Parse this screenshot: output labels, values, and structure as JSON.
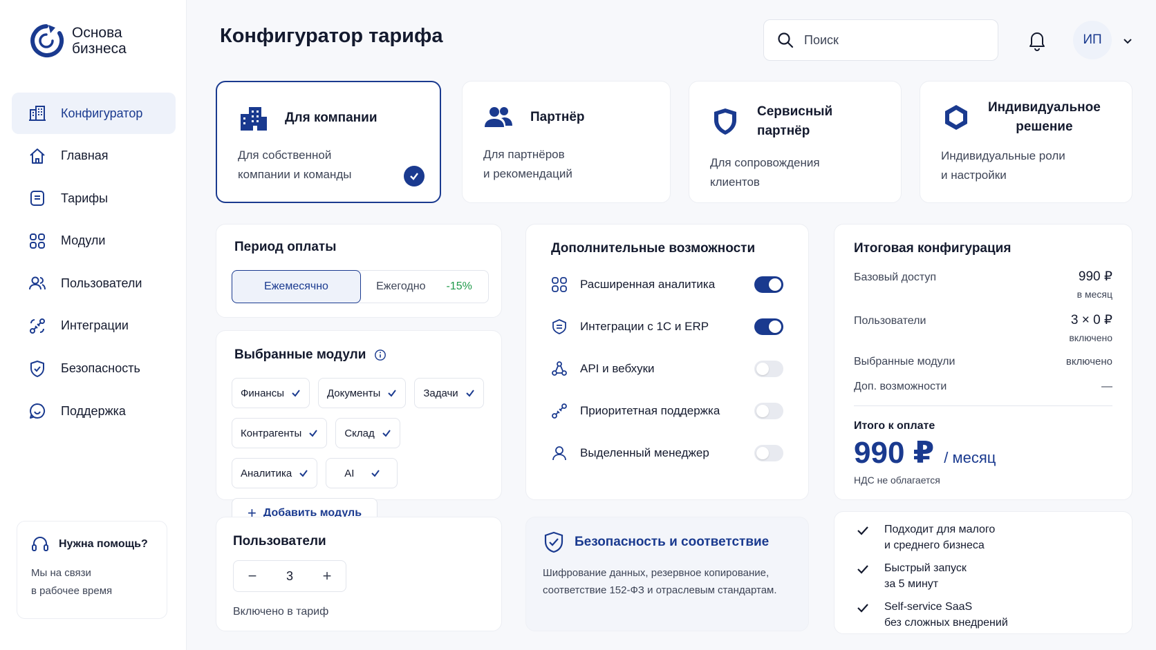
{
  "brand": {
    "line1": "Основа",
    "line2": "бизнеса"
  },
  "sidebar": {
    "items": [
      {
        "label": "Конфигуратор",
        "icon": "building-icon"
      },
      {
        "label": "Главная",
        "icon": "home-icon"
      },
      {
        "label": "Тарифы",
        "icon": "tariff-icon"
      },
      {
        "label": "Модули",
        "icon": "modules-icon"
      },
      {
        "label": "Пользователи",
        "icon": "users-icon"
      },
      {
        "label": "Интеграции",
        "icon": "integrations-icon"
      },
      {
        "label": "Безопасность",
        "icon": "shield-icon"
      },
      {
        "label": "Поддержка",
        "icon": "chat-icon"
      }
    ],
    "help": {
      "title": "Нужна помощь?",
      "line1": "Мы на связи",
      "line2": "в рабочее время"
    }
  },
  "header": {
    "title": "Конфигуратор тарифа",
    "search_placeholder": "Поиск",
    "avatar": "ИП"
  },
  "plans": [
    {
      "name": "Для компании",
      "desc1": "Для собственной",
      "desc2": "компании и команды",
      "selected": true
    },
    {
      "name": "Партнёр",
      "desc1": "Для партнёров",
      "desc2": "и рекомендаций"
    },
    {
      "name": "Сервисный партнёр",
      "desc1": "Для сопровождения",
      "desc2": "клиентов"
    },
    {
      "name1": "Индивидуальное",
      "name2": "решение",
      "desc1": "Индивидуальные роли",
      "desc2": "и настройки"
    }
  ],
  "period": {
    "title": "Период оплаты",
    "monthly": "Ежемесячно",
    "yearly": "Ежегодно",
    "discount": "-15%"
  },
  "modules": {
    "title": "Выбранные модули",
    "chips": [
      "Финансы",
      "Документы",
      "Задачи",
      "Контрагенты",
      "Склад",
      "Аналитика",
      "AI"
    ],
    "add_label": "Добавить модуль"
  },
  "users": {
    "title": "Пользователи",
    "minus": "−",
    "count": "3",
    "plus": "+",
    "note": "Включено в тариф"
  },
  "features": {
    "title": "Дополнительные возможности",
    "items": [
      {
        "label": "Расширенная аналитика",
        "on": true
      },
      {
        "label": "Интеграции с 1С и ERP",
        "on": true
      },
      {
        "label": "API и вебхуки",
        "on": false
      },
      {
        "label": "Приоритетная поддержка",
        "on": false
      },
      {
        "label": "Выделенный менеджер",
        "on": false
      }
    ]
  },
  "security": {
    "title": "Безопасность и соответствие",
    "line1": "Шифрование данных, резервное копирование,",
    "line2": "соответствие 152-ФЗ и отраслевым стандартам."
  },
  "summary": {
    "title": "Итоговая конфигурация",
    "base_label": "Базовый доступ",
    "base_value": "990 ₽",
    "base_sub": "в месяц",
    "users_label": "Пользователи",
    "users_value": "3 × 0 ₽",
    "users_sub": "включено",
    "modules_label": "Выбранные модули",
    "modules_value": "включено",
    "extras_label": "Доп. возможности",
    "extras_value": "—",
    "total_label": "Итого к оплате",
    "total_price": "990 ₽",
    "total_per": "/  месяц",
    "vat": "НДС не облагается"
  },
  "benefits": [
    {
      "line1": "Подходит для малого",
      "line2": "и среднего бизнеса"
    },
    {
      "line1": "Быстрый запуск",
      "line2": "за 5 минут"
    },
    {
      "line1": "Self-service SaaS",
      "line2": "без сложных внедрений"
    }
  ],
  "colors": {
    "primary": "#1a3a8f",
    "accent_green": "#1f9a4a",
    "background": "#f7f8fb"
  }
}
